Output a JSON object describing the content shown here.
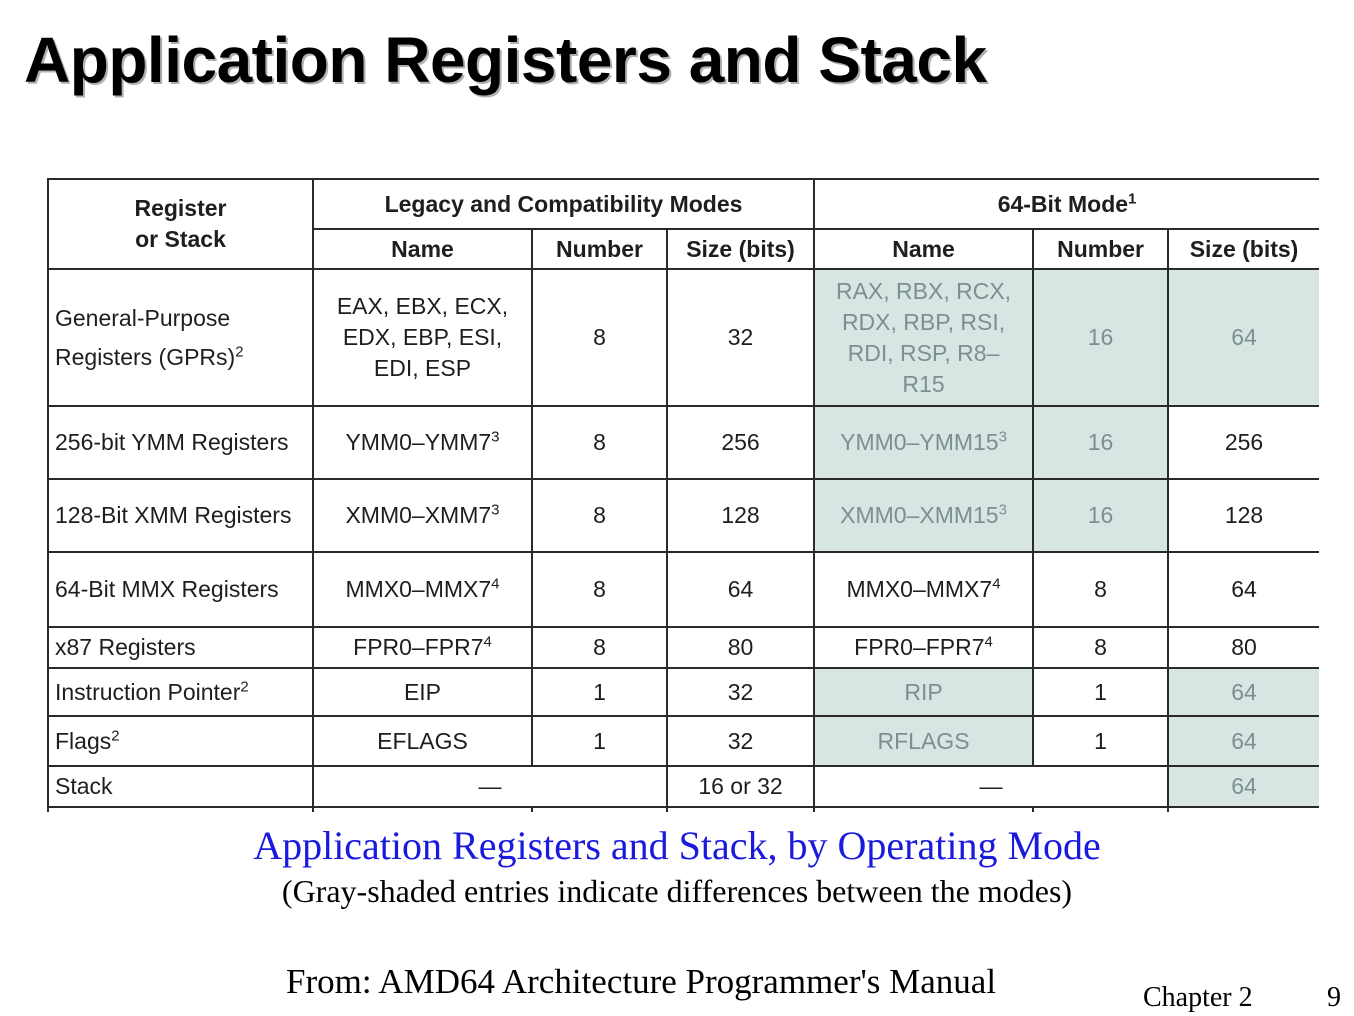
{
  "title": "Application Registers and Stack",
  "table": {
    "header_register": "Register\nor Stack",
    "header_legacy": "Legacy and Compatibility Modes",
    "header_64bit": "64-Bit Mode",
    "header_64bit_note": "1",
    "col_name": "Name",
    "col_number": "Number",
    "col_size": "Size (bits)",
    "rows": [
      {
        "label": "General-Purpose Registers (GPRs)",
        "label_note": "2",
        "legacy_name": "EAX, EBX, ECX, EDX, EBP, ESI, EDI, ESP",
        "legacy_name_note": "",
        "legacy_number": "8",
        "legacy_size": "32",
        "mode64_name": "RAX, RBX, RCX, RDX, RBP, RSI, RDI, RSP, R8–R15",
        "mode64_name_note": "",
        "mode64_number": "16",
        "mode64_size": "64"
      },
      {
        "label": "256-bit YMM Registers",
        "label_note": "",
        "legacy_name": "YMM0–YMM7",
        "legacy_name_note": "3",
        "legacy_number": "8",
        "legacy_size": "256",
        "mode64_name": "YMM0–YMM15",
        "mode64_name_note": "3",
        "mode64_number": "16",
        "mode64_size": "256"
      },
      {
        "label": "128-Bit XMM Registers",
        "label_note": "",
        "legacy_name": "XMM0–XMM7",
        "legacy_name_note": "3",
        "legacy_number": "8",
        "legacy_size": "128",
        "mode64_name": "XMM0–XMM15",
        "mode64_name_note": "3",
        "mode64_number": "16",
        "mode64_size": "128"
      },
      {
        "label": "64-Bit MMX Registers",
        "label_note": "",
        "legacy_name": "MMX0–MMX7",
        "legacy_name_note": "4",
        "legacy_number": "8",
        "legacy_size": "64",
        "mode64_name": "MMX0–MMX7",
        "mode64_name_note": "4",
        "mode64_number": "8",
        "mode64_size": "64"
      },
      {
        "label": "x87 Registers",
        "label_note": "",
        "legacy_name": "FPR0–FPR7",
        "legacy_name_note": "4",
        "legacy_number": "8",
        "legacy_size": "80",
        "mode64_name": "FPR0–FPR7",
        "mode64_name_note": "4",
        "mode64_number": "8",
        "mode64_size": "80"
      },
      {
        "label": "Instruction Pointer",
        "label_note": "2",
        "legacy_name": "EIP",
        "legacy_name_note": "",
        "legacy_number": "1",
        "legacy_size": "32",
        "mode64_name": "RIP",
        "mode64_name_note": "",
        "mode64_number": "1",
        "mode64_size": "64"
      },
      {
        "label": "Flags",
        "label_note": "2",
        "legacy_name": "EFLAGS",
        "legacy_name_note": "",
        "legacy_number": "1",
        "legacy_size": "32",
        "mode64_name": "RFLAGS",
        "mode64_name_note": "",
        "mode64_number": "1",
        "mode64_size": "64"
      },
      {
        "label": "Stack",
        "label_note": "",
        "legacy_namenumber": "—",
        "legacy_size": "16 or 32",
        "mode64_namenumber": "—",
        "mode64_size": "64"
      }
    ]
  },
  "caption_title": "Application Registers and Stack, by Operating Mode",
  "caption_note": "(Gray-shaded entries indicate differences between the modes)",
  "source": "From:  AMD64 Architecture Programmer's Manual",
  "chapter": "Chapter 2",
  "page_number": "9",
  "colors": {
    "shade": "#d7e6e3",
    "shaded_text": "#7d8f8e",
    "caption_blue": "#1a1adf"
  }
}
